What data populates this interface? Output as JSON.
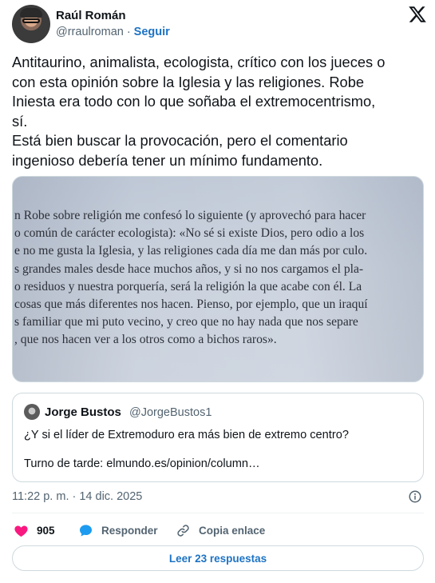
{
  "author": {
    "name": "Raúl Román",
    "handle": "@rraulroman",
    "separator": "·",
    "follow_label": "Seguir"
  },
  "tweet": {
    "lines": [
      "Antitaurino, animalista, ecologista,  crítico con los jueces o",
      "con esta opinión sobre la Iglesia y las religiones. Robe",
      "Iniesta era todo con lo que soñaba el extremocentrismo,",
      "sí.",
      "Está bien buscar la provocación, pero el comentario",
      "ingenioso debería tener un mínimo fundamento."
    ]
  },
  "photo": {
    "lines": [
      "n Robe sobre religión me confesó lo siguiente (y aprovechó para hacer",
      "o común de carácter ecologista): «No sé si existe Dios, pero odio a los",
      "e no me gusta la Iglesia, y las religiones cada día me dan más por culo.",
      "s grandes males desde hace muchos años, y si no nos cargamos el pla-",
      "o residuos y nuestra porquería, será la religión la que acabe con él. La",
      "cosas que más diferentes nos hacen. Pienso, por ejemplo, que un iraquí",
      "s familiar que mi puto vecino, y creo que no hay nada que nos separe",
      ", que nos hacen ver a los otros como a bichos raros»."
    ]
  },
  "quote": {
    "name": "Jorge Bustos",
    "handle": "@JorgeBustos1",
    "text": "¿Y si el líder de Extremoduro era más bien de extremo centro?",
    "link_line": "Turno de tarde: elmundo.es/opinion/column…"
  },
  "timestamp": "11:22 p. m. · 14 dic. 2025",
  "actions": {
    "likes": "905",
    "reply_label": "Responder",
    "copy_label": "Copia enlace"
  },
  "read_more_label": "Leer 23 respuestas",
  "colors": {
    "accent": "#1d73c4",
    "like": "#f91880",
    "text": "#0f1419",
    "muted": "#536471",
    "reply_icon": "#1d9bf0"
  }
}
